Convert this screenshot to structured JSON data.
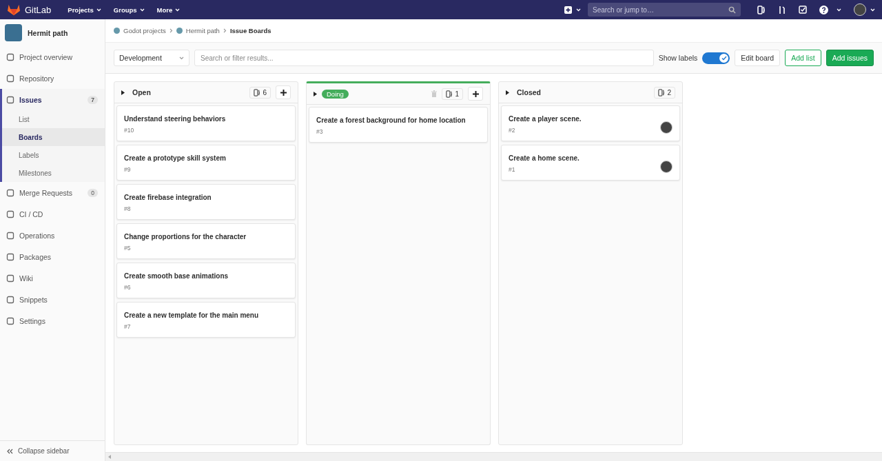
{
  "navbar": {
    "brand": "GitLab",
    "menus": [
      "Projects",
      "Groups",
      "More"
    ],
    "search": {
      "placeholder": "Search or jump to…"
    }
  },
  "sidebar": {
    "project": "Hermit path",
    "items": [
      {
        "label": "Project overview",
        "selected": false
      },
      {
        "label": "Repository",
        "selected": false
      },
      {
        "label": "Issues",
        "selected": true,
        "count": "7",
        "children": [
          {
            "label": "List",
            "selected": false
          },
          {
            "label": "Boards",
            "selected": true
          },
          {
            "label": "Labels",
            "selected": false
          },
          {
            "label": "Milestones",
            "selected": false
          }
        ]
      },
      {
        "label": "Merge Requests",
        "selected": false,
        "count": "0"
      },
      {
        "label": "CI / CD",
        "selected": false
      },
      {
        "label": "Operations",
        "selected": false
      },
      {
        "label": "Packages",
        "selected": false
      },
      {
        "label": "Wiki",
        "selected": false
      },
      {
        "label": "Snippets",
        "selected": false
      },
      {
        "label": "Settings",
        "selected": false
      }
    ],
    "collapse": "Collapse sidebar"
  },
  "breadcrumbs": [
    "Godot projects",
    "Hermit path",
    "Issue Boards"
  ],
  "filter_bar": {
    "board": "Development",
    "search": {
      "placeholder": "Search or filter results..."
    },
    "show_labels": {
      "label": "Show labels",
      "on": true
    },
    "buttons": [
      "Edit board",
      "Add list",
      "Add issues"
    ]
  },
  "lists": [
    {
      "title": "Open",
      "kind": "plain",
      "count": "6",
      "can_add": true,
      "can_delete": false,
      "cards": [
        {
          "title": "Understand steering behaviors",
          "number": "#10",
          "assigned": false
        },
        {
          "title": "Create a prototype skill system",
          "number": "#9",
          "assigned": false
        },
        {
          "title": "Create firebase integration",
          "number": "#8",
          "assigned": false
        },
        {
          "title": "Change proportions for the character",
          "number": "#5",
          "assigned": false
        },
        {
          "title": "Create smooth base animations",
          "number": "#6",
          "assigned": false
        },
        {
          "title": "Create a new template for the main menu",
          "number": "#7",
          "assigned": false
        }
      ]
    },
    {
      "title": "Doing",
      "kind": "label",
      "color": "#44ad5b",
      "count": "1",
      "can_add": true,
      "can_delete": true,
      "cards": [
        {
          "title": "Create a forest background for home location",
          "number": "#3",
          "assigned": false
        }
      ]
    },
    {
      "title": "Closed",
      "kind": "plain",
      "count": "2",
      "can_add": false,
      "can_delete": false,
      "cards": [
        {
          "title": "Create a player scene.",
          "number": "#2",
          "assigned": true
        },
        {
          "title": "Create a home scene.",
          "number": "#1",
          "assigned": true
        }
      ]
    }
  ]
}
